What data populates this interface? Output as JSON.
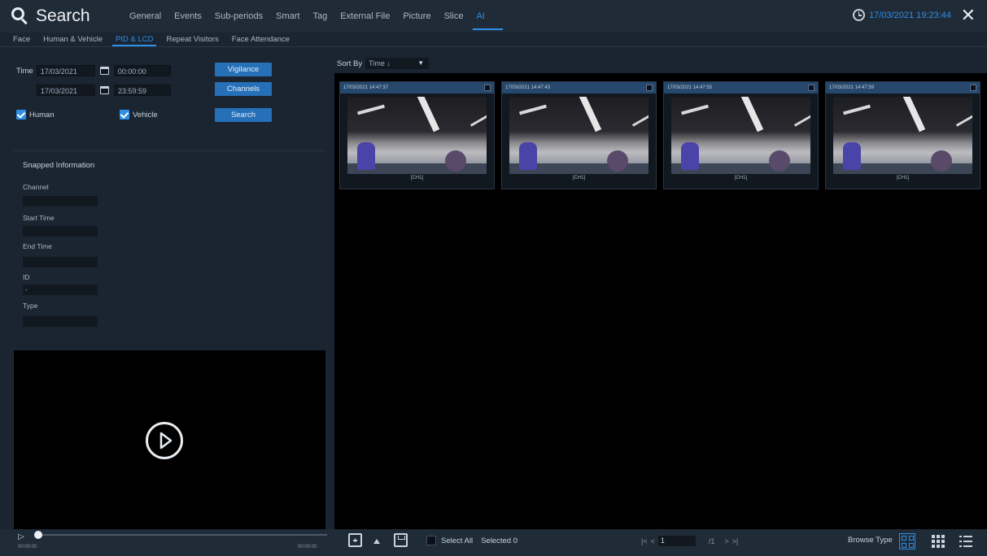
{
  "header": {
    "title": "Search",
    "tabs": [
      "General",
      "Events",
      "Sub-periods",
      "Smart",
      "Tag",
      "External File",
      "Picture",
      "Slice",
      "AI"
    ],
    "active_tab": "AI",
    "datetime": "17/03/2021 19:23:44",
    "close_label": "✕"
  },
  "subtabs": {
    "items": [
      "Face",
      "Human & Vehicle",
      "PID & LCD",
      "Repeat Visitors",
      "Face Attendance"
    ],
    "active": "PID & LCD"
  },
  "filters": {
    "time_label": "Time",
    "start_date": "17/03/2021",
    "start_time": "00:00:00",
    "end_date": "17/03/2021",
    "end_time": "23:59:59",
    "vigilance_label": "Vigilance",
    "channels_label": "Channels",
    "search_label": "Search",
    "human_label": "Human",
    "vehicle_label": "Vehicle",
    "human_checked": true,
    "vehicle_checked": true
  },
  "snapped": {
    "title": "Snapped Information",
    "channel_label": "Channel",
    "channel_value": "",
    "start_label": "Start Time",
    "start_value": "",
    "end_label": "End Time",
    "end_value": "",
    "id_label": "ID",
    "id_value": "-",
    "type_label": "Type",
    "type_value": ""
  },
  "player": {
    "time_start": "00:00:00",
    "time_end": "00:00:00"
  },
  "results": {
    "sort_label": "Sort By",
    "sort_value": "Time ↓",
    "items": [
      {
        "stamp": "17/03/2021 14:47:37",
        "caption": "[CH1]"
      },
      {
        "stamp": "17/03/2021 14:47:43",
        "caption": "[CH1]"
      },
      {
        "stamp": "17/03/2021 14:47:55",
        "caption": "[CH1]"
      },
      {
        "stamp": "17/03/2021 14:47:59",
        "caption": "[CH1]"
      }
    ]
  },
  "bottom": {
    "select_all": "Select All",
    "selected": "Selected 0",
    "page_current": "1",
    "page_total": "/1",
    "browse_type": "Browse Type"
  },
  "colors": {
    "accent": "#2d8fe6",
    "button": "#2670b8",
    "background": "#1b2532",
    "panel_black": "#000000"
  }
}
